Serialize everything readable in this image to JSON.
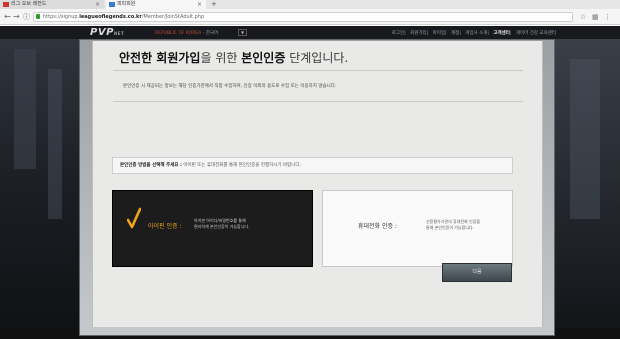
{
  "browser": {
    "tabs": [
      {
        "label": "리그 오브 레전드",
        "active": false
      },
      {
        "label": "피피회원",
        "active": true
      }
    ],
    "new_tab": "+",
    "url_prefix": "https://signup.",
    "url_domain": "leagueoflegends.co.kr",
    "url_path": "/Member/JoinStAdult.php",
    "nav": {
      "back": "←",
      "forward": "→",
      "info": "ⓘ"
    }
  },
  "site": {
    "logo": "PVP",
    "logo_sub": "NET",
    "region_label": "REPUBLIC OF KOREA",
    "region_lang": "- 한국어",
    "region_toggle": "▼",
    "top_links": [
      "로그인",
      "회원가입",
      "마이업",
      "계정",
      "게임사 소개",
      "고객센터",
      "게이머 건강 교육센터"
    ],
    "active_link_index": 5
  },
  "content": {
    "title_a": "안전한 회원가입",
    "title_b": "을 위한 ",
    "title_c": "본인인증",
    "title_d": " 단계입니다.",
    "description": "본인인증 시 제공되는 정보는 해당 인증기관에서 직접 수집하며, 인증 이외의 용도로 수집 또는 이용하지 않습니다.",
    "choose_bold": "본인인증 방법을 선택해 주세요 :",
    "choose_rest": " 아이핀 또는 휴대전화를 통해 본인인증을 진행하시기 바랍니다.",
    "options": {
      "ipin": {
        "label": "아이핀 인증 :",
        "line1": "아이핀 아이디/비밀번호를 통해",
        "line2": "편리하게 본인인증이 가능합니다.",
        "selected": true
      },
      "phone": {
        "label": "휴대전화 인증 :",
        "line1": "신용평가기관의 휴대전화 인증을",
        "line2": "통해 본인인증이 가능합니다.",
        "selected": false
      }
    },
    "next_button": "다음"
  },
  "colors": {
    "accent_orange": "#f0a31b",
    "region_red": "#c24b3b",
    "panel_bg": "#e9e9e7"
  }
}
